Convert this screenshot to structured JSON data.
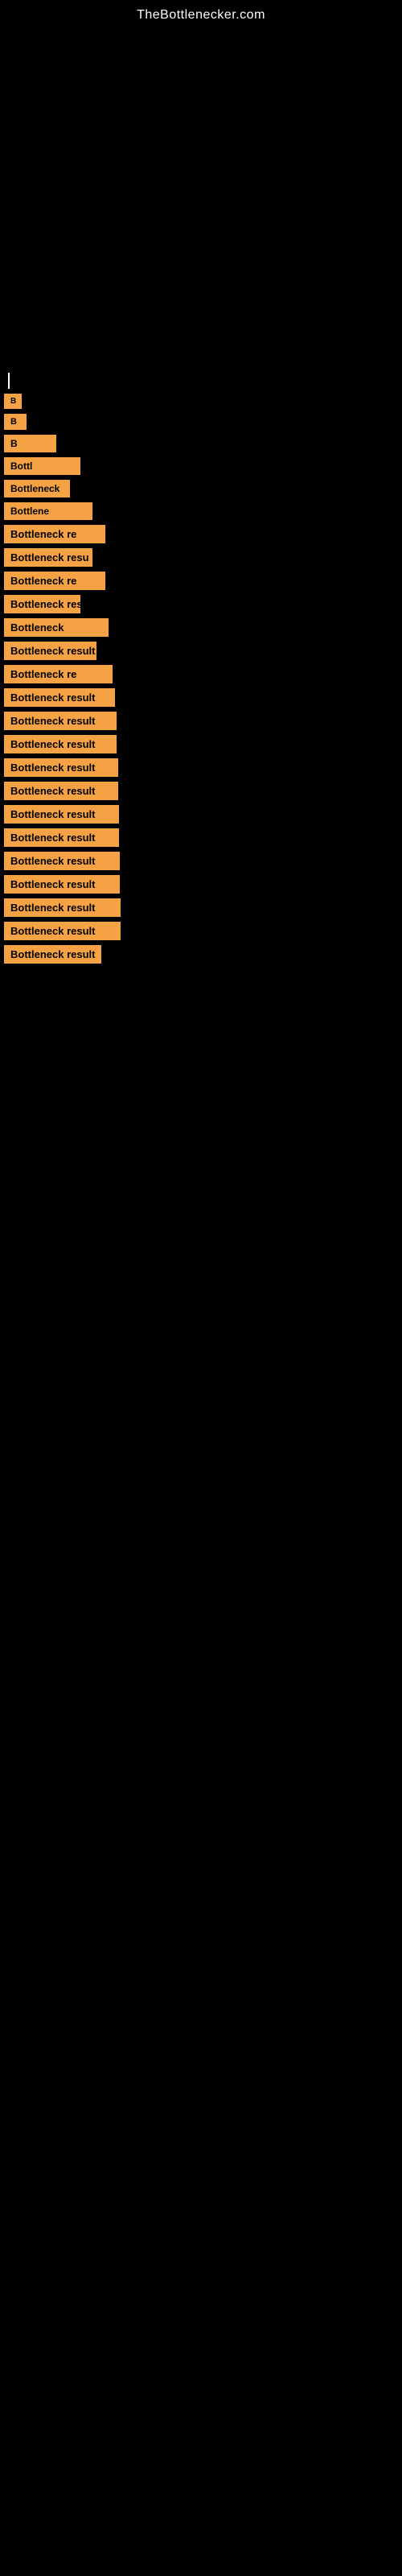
{
  "site": {
    "title": "TheBottlenecker.com"
  },
  "results": [
    {
      "id": 1,
      "label": "B",
      "full_label": "Bottleneck result"
    },
    {
      "id": 2,
      "label": "B",
      "full_label": "Bottleneck result"
    },
    {
      "id": 3,
      "label": "B",
      "full_label": "Bottleneck result"
    },
    {
      "id": 4,
      "label": "Bottl",
      "full_label": "Bottleneck result"
    },
    {
      "id": 5,
      "label": "Bottleneck",
      "full_label": "Bottleneck result"
    },
    {
      "id": 6,
      "label": "Bottlene",
      "full_label": "Bottleneck result"
    },
    {
      "id": 7,
      "label": "Bottleneck re",
      "full_label": "Bottleneck result"
    },
    {
      "id": 8,
      "label": "Bottleneck resu",
      "full_label": "Bottleneck result"
    },
    {
      "id": 9,
      "label": "Bottleneck re",
      "full_label": "Bottleneck result"
    },
    {
      "id": 10,
      "label": "Bottleneck res",
      "full_label": "Bottleneck result"
    },
    {
      "id": 11,
      "label": "Bottleneck",
      "full_label": "Bottleneck result"
    },
    {
      "id": 12,
      "label": "Bottleneck result",
      "full_label": "Bottleneck result"
    },
    {
      "id": 13,
      "label": "Bottleneck re",
      "full_label": "Bottleneck result"
    },
    {
      "id": 14,
      "label": "Bottleneck result",
      "full_label": "Bottleneck result"
    },
    {
      "id": 15,
      "label": "Bottleneck result",
      "full_label": "Bottleneck result"
    },
    {
      "id": 16,
      "label": "Bottleneck result",
      "full_label": "Bottleneck result"
    },
    {
      "id": 17,
      "label": "Bottleneck result",
      "full_label": "Bottleneck result"
    },
    {
      "id": 18,
      "label": "Bottleneck result",
      "full_label": "Bottleneck result"
    },
    {
      "id": 19,
      "label": "Bottleneck result",
      "full_label": "Bottleneck result"
    },
    {
      "id": 20,
      "label": "Bottleneck result",
      "full_label": "Bottleneck result"
    },
    {
      "id": 21,
      "label": "Bottleneck result",
      "full_label": "Bottleneck result"
    },
    {
      "id": 22,
      "label": "Bottleneck result",
      "full_label": "Bottleneck result"
    },
    {
      "id": 23,
      "label": "Bottleneck result",
      "full_label": "Bottleneck result"
    },
    {
      "id": 24,
      "label": "Bottleneck result",
      "full_label": "Bottleneck result"
    },
    {
      "id": 25,
      "label": "Bottleneck result",
      "full_label": "Bottleneck result"
    }
  ],
  "colors": {
    "background": "#000000",
    "label_bg": "#f4a244",
    "label_text": "#000000",
    "title_text": "#ffffff"
  }
}
